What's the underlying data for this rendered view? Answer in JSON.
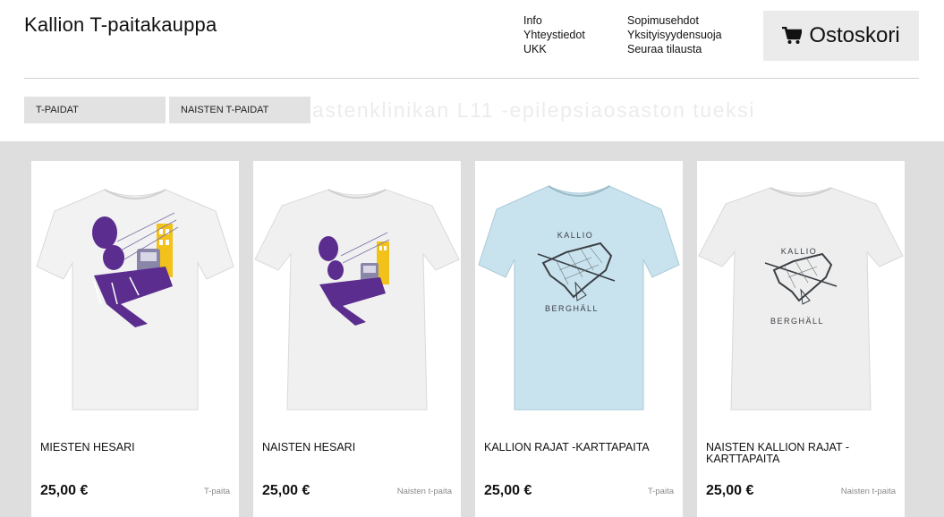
{
  "header": {
    "title": "Kallion T-paitakauppa",
    "links_col1": [
      "Info",
      "Yhteystiedot",
      "UKK"
    ],
    "links_col2": [
      "Sopimusehdot",
      "Yksityisyydensuoja",
      "Seuraa tilausta"
    ],
    "cart_label": "Ostoskori",
    "cart_icon": "shopping-cart-icon"
  },
  "nav": {
    "items": [
      "T-PAIDAT",
      "NAISTEN T-PAIDAT"
    ],
    "banner_text": "astenklinikan L11 -epilepsiaosaston tueksi"
  },
  "products": [
    {
      "name": "MIESTEN HESARI",
      "price": "25,00 €",
      "category": "T-paita",
      "shirt_color": "#f2f2f2",
      "print": "hesari"
    },
    {
      "name": "NAISTEN HESARI",
      "price": "25,00 €",
      "category": "Naisten t-paita",
      "shirt_color": "#f0f0f0",
      "print": "hesari"
    },
    {
      "name": "KALLION RAJAT -KARTTAPAITA",
      "price": "25,00 €",
      "category": "T-paita",
      "shirt_color": "#c9e3ee",
      "print": "map",
      "print_labels": [
        "KALLIO",
        "BERGHÄLL"
      ]
    },
    {
      "name": "NAISTEN KALLION RAJAT -KARTTAPAITA",
      "price": "25,00 €",
      "category": "Naisten t-paita",
      "shirt_color": "#eeeeee",
      "print": "map",
      "print_labels": [
        "KALLIO",
        "BERGHÄLL"
      ]
    }
  ],
  "colors": {
    "print_purple": "#5b2d8e",
    "print_yellow": "#f2c21b",
    "background_grey": "#dedede",
    "nav_grey": "#e2e2e2"
  }
}
